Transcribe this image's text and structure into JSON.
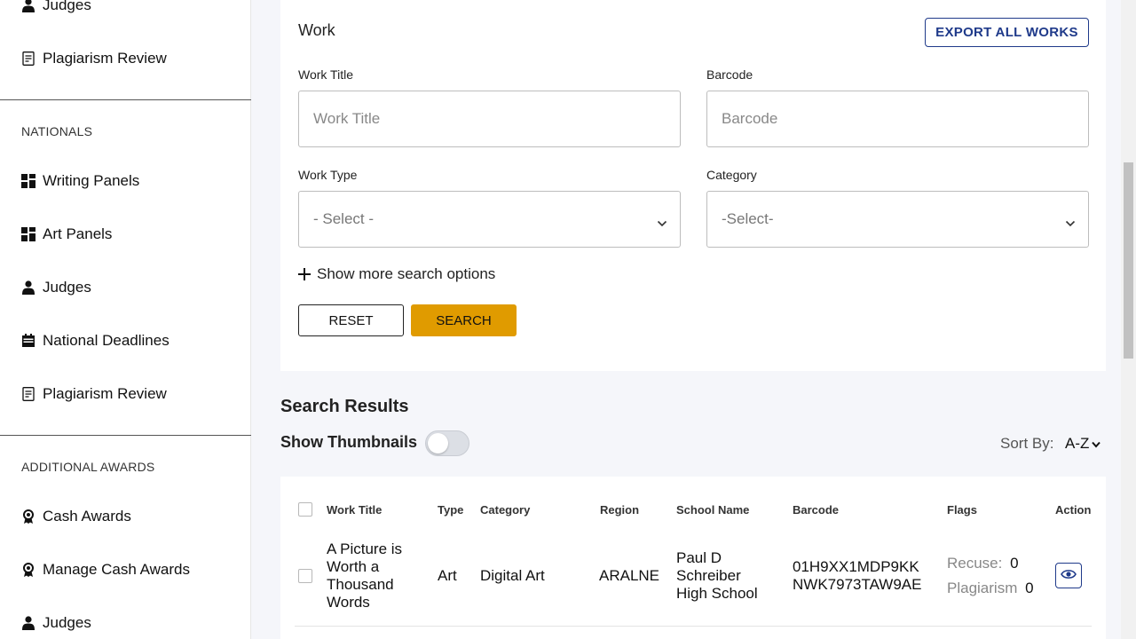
{
  "sidebar": {
    "top_items": [
      {
        "label": "Judges",
        "icon": "person-icon"
      },
      {
        "label": "Plagiarism Review",
        "icon": "document-check-icon"
      }
    ],
    "nationals": {
      "heading": "NATIONALS",
      "items": [
        {
          "label": "Writing Panels",
          "icon": "grid-icon"
        },
        {
          "label": "Art Panels",
          "icon": "grid-icon"
        },
        {
          "label": "Judges",
          "icon": "person-icon"
        },
        {
          "label": "National Deadlines",
          "icon": "calendar-icon"
        },
        {
          "label": "Plagiarism Review",
          "icon": "document-check-icon"
        }
      ]
    },
    "additional_awards": {
      "heading": "ADDITIONAL AWARDS",
      "items": [
        {
          "label": "Cash Awards",
          "icon": "award-icon"
        },
        {
          "label": "Manage Cash Awards",
          "icon": "award-icon"
        },
        {
          "label": "Judges",
          "icon": "person-icon"
        }
      ]
    }
  },
  "search": {
    "title": "Work",
    "export_label": "EXPORT ALL WORKS",
    "work_title_label": "Work Title",
    "work_title_placeholder": "Work Title",
    "barcode_label": "Barcode",
    "barcode_placeholder": "Barcode",
    "work_type_label": "Work Type",
    "work_type_value": "- Select -",
    "category_label": "Category",
    "category_value": "-Select-",
    "more_options_label": "Show more search options",
    "reset_label": "RESET",
    "search_label": "SEARCH"
  },
  "results": {
    "title": "Search Results",
    "thumbnails_label": "Show Thumbnails",
    "thumbnails_on": false,
    "sort_label": "Sort By:",
    "sort_value": "A-Z",
    "columns": {
      "work_title": "Work Title",
      "type": "Type",
      "category": "Category",
      "region": "Region",
      "school": "School Name",
      "barcode": "Barcode",
      "flags": "Flags",
      "action": "Action"
    },
    "rows": [
      {
        "work_title": "A Picture is Worth a Thousand Words",
        "type": "Art",
        "category": "Digital Art",
        "region": "ARALNE",
        "school": "Paul D Schreiber High School",
        "barcode": "01H9XX1MDP9KKNWK7973TAW9AE",
        "recuse_label": "Recuse:",
        "recuse_count": "0",
        "plagiarism_label": "Plagiarism",
        "plagiarism_count": "0"
      }
    ]
  },
  "colors": {
    "accent": "#1f3a8a",
    "search_button": "#e09b00",
    "background": "#f5f6fa"
  }
}
